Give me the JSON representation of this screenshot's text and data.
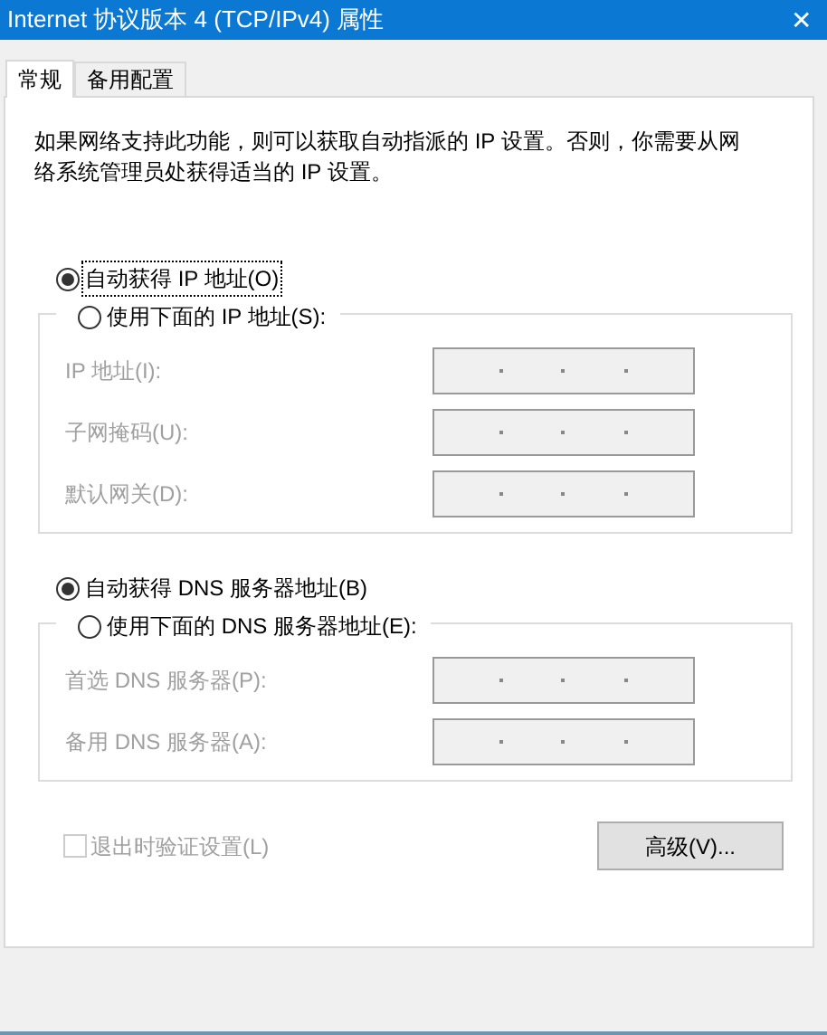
{
  "window": {
    "title": "Internet 协议版本 4 (TCP/IPv4) 属性",
    "close": "✕"
  },
  "tabs": [
    {
      "label": "常规",
      "selected": true
    },
    {
      "label": "备用配置",
      "selected": false
    }
  ],
  "description": "如果网络支持此功能，则可以获取自动指派的 IP 设置。否则，你需要从网络系统管理员处获得适当的 IP 设置。",
  "sections": [
    {
      "options": [
        {
          "label": "自动获得 IP 地址(O)",
          "selected": true,
          "focused": true
        },
        {
          "label": "使用下面的 IP 地址(S):",
          "selected": false,
          "focused": false
        }
      ],
      "fields": [
        {
          "label": "IP 地址(I):",
          "disabled": true
        },
        {
          "label": "子网掩码(U):",
          "disabled": true
        },
        {
          "label": "默认网关(D):",
          "disabled": true
        }
      ]
    },
    {
      "options": [
        {
          "label": "自动获得 DNS 服务器地址(B)",
          "selected": true,
          "focused": false
        },
        {
          "label": "使用下面的 DNS 服务器地址(E):",
          "selected": false,
          "focused": false
        }
      ],
      "fields": [
        {
          "label": "首选 DNS 服务器(P):",
          "disabled": true
        },
        {
          "label": "备用 DNS 服务器(A):",
          "disabled": true
        }
      ]
    }
  ],
  "validate": {
    "label": "退出时验证设置(L)",
    "checked": false,
    "disabled": true
  },
  "advanced_button": "高级(V)..."
}
